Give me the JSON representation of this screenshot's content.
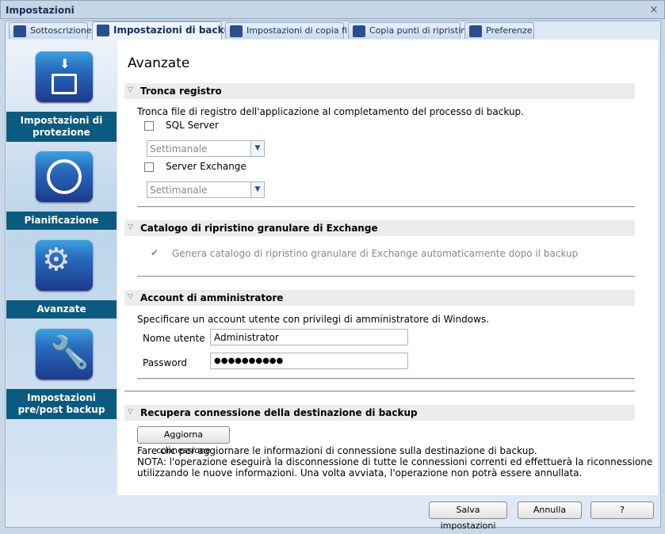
{
  "window": {
    "title": "Impostazioni",
    "close": "×"
  },
  "tabs": [
    {
      "label": "Sottoscrizione"
    },
    {
      "label": "Impostazioni di backup"
    },
    {
      "label": "Impostazioni di copia file"
    },
    {
      "label": "Copia punti di ripristino"
    },
    {
      "label": "Preferenze"
    }
  ],
  "sidebar": [
    {
      "label": "Impostazioni di protezione"
    },
    {
      "label": "Pianificazione"
    },
    {
      "label": "Avanzate"
    },
    {
      "label": "Impostazioni pre/post backup"
    }
  ],
  "main": {
    "title": "Avanzate",
    "truncate": {
      "header": "Tronca registro",
      "desc": "Tronca file di registro dell'applicazione al completamento del processo di backup.",
      "sql_label": "SQL Server",
      "sql_freq": "Settimanale",
      "exchange_label": "Server Exchange",
      "exchange_freq": "Settimanale"
    },
    "catalog": {
      "header": "Catalogo di ripristino granulare di Exchange",
      "option": "Genera catalogo di ripristino granulare di Exchange automaticamente dopo il backup",
      "checked": true
    },
    "admin": {
      "header": "Account di amministratore",
      "desc": "Specificare un account utente con privilegi di amministratore di Windows.",
      "user_label": "Nome utente",
      "user_value": "Administrator",
      "password_label": "Password",
      "password_value": "●●●●●●●●●●"
    },
    "reconnect": {
      "header": "Recupera connessione della destinazione di backup",
      "button": "Aggiorna connessione",
      "line1": "Fare clic per aggiornare le informazioni di connessione sulla destinazione di backup.",
      "line2": "NOTA: l'operazione eseguirà la disconnessione di tutte le connessioni correnti ed effettuerà la riconnessione",
      "line3": "utilizzando le nuove informazioni. Una volta avviata, l'operazione non potrà essere annullata."
    }
  },
  "footer": {
    "save": "Salva impostazioni",
    "cancel": "Annulla",
    "help": "?"
  }
}
